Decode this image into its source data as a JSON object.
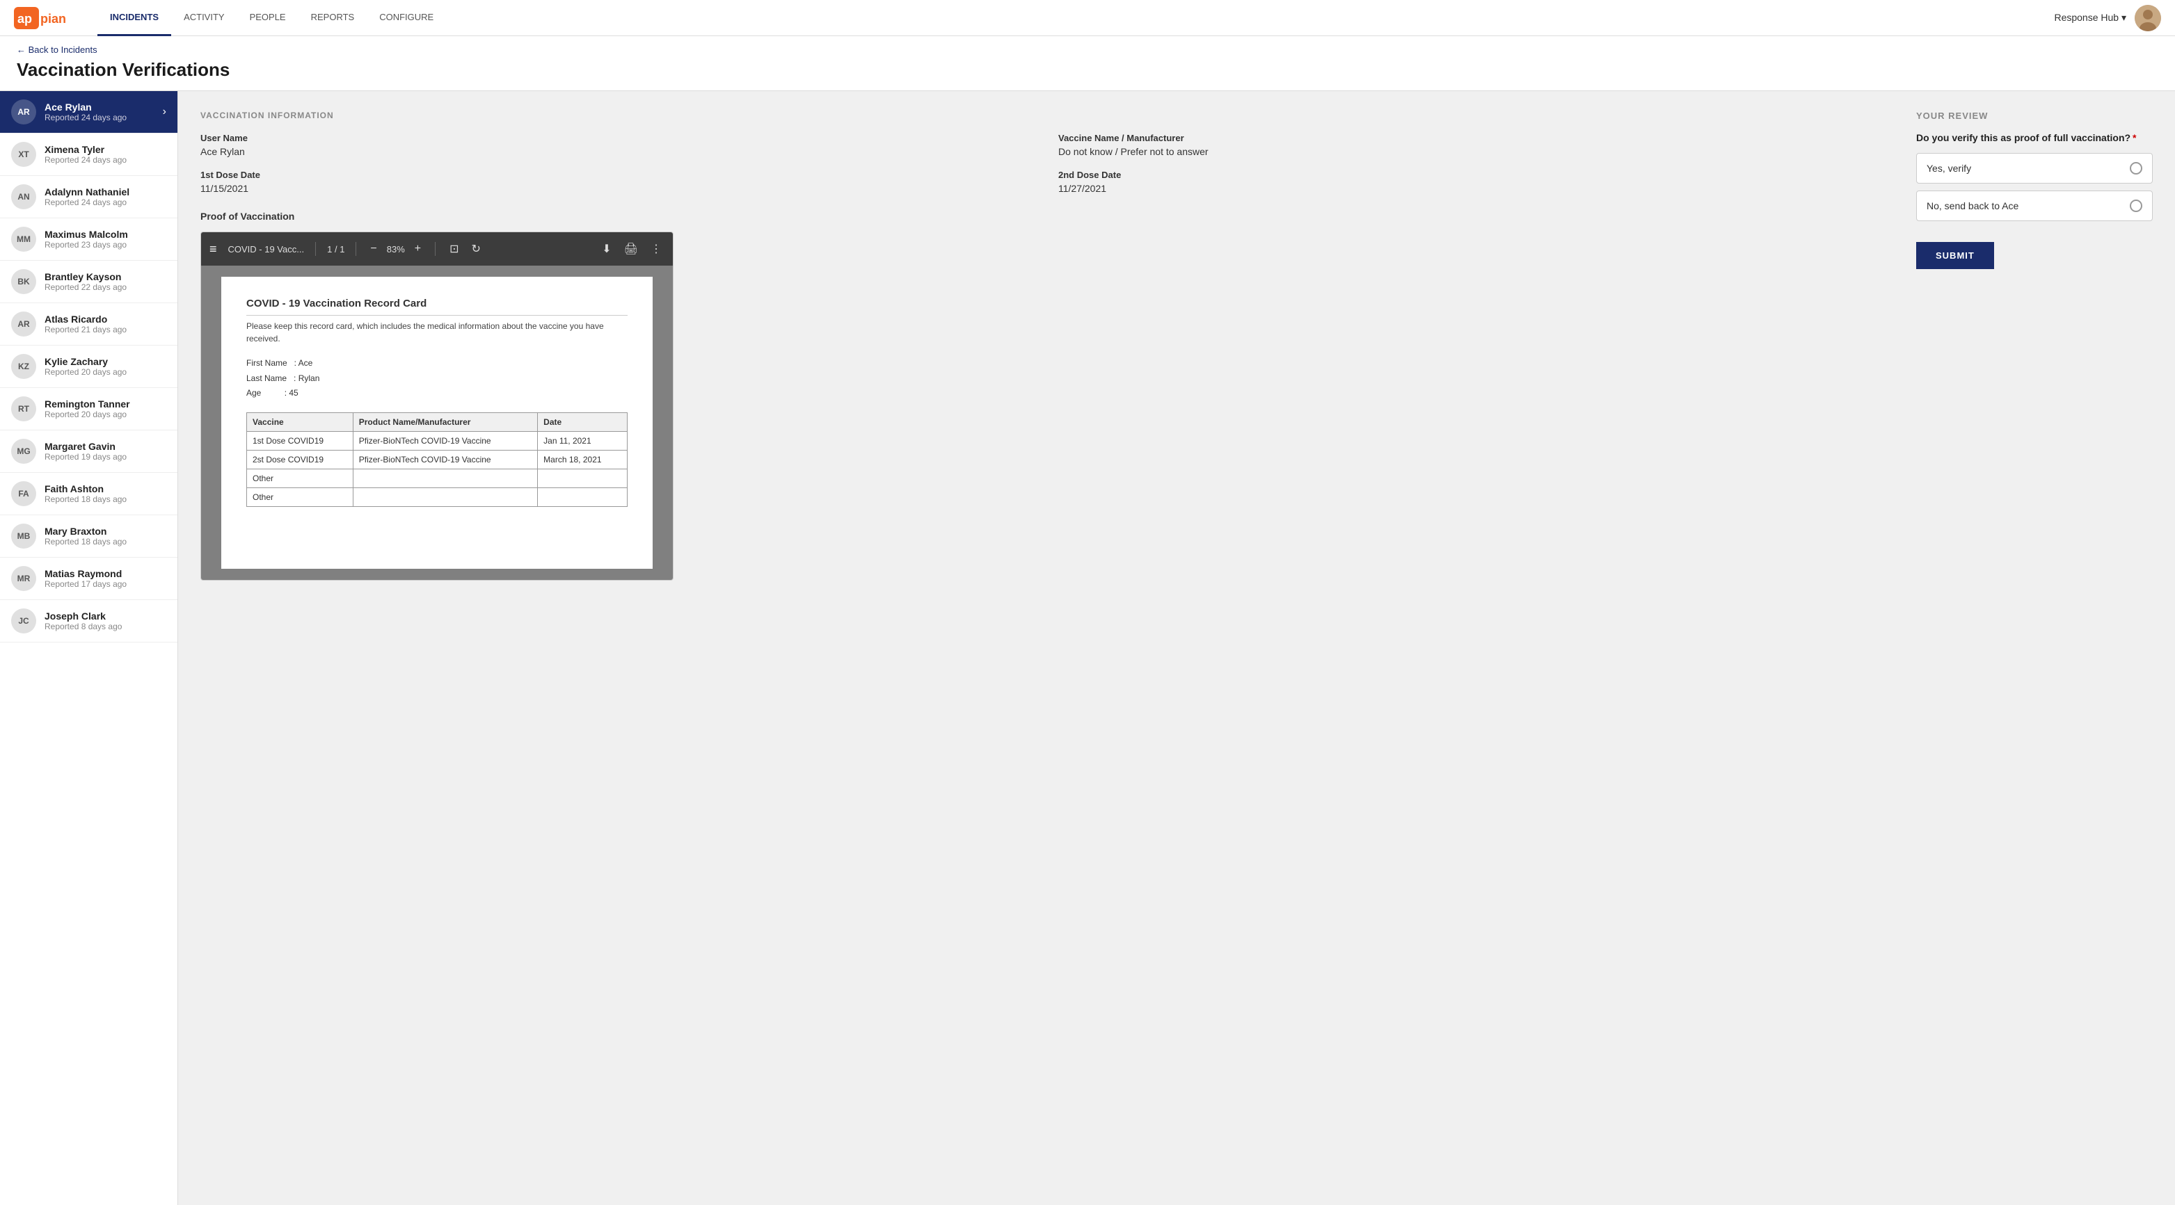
{
  "nav": {
    "links": [
      {
        "id": "incidents",
        "label": "INCIDENTS",
        "active": true
      },
      {
        "id": "activity",
        "label": "ACTIVITY",
        "active": false
      },
      {
        "id": "people",
        "label": "PEOPLE",
        "active": false
      },
      {
        "id": "reports",
        "label": "REPORTS",
        "active": false
      },
      {
        "id": "configure",
        "label": "CONFIGURE",
        "active": false
      }
    ],
    "app_name": "Response Hub",
    "dropdown_arrow": "▾"
  },
  "header": {
    "back_label": "← Back to Incidents",
    "title": "Vaccination Verifications"
  },
  "sidebar": {
    "items": [
      {
        "id": "ace-rylan",
        "initials": "AR",
        "name": "Ace Rylan",
        "sub": "Reported 24 days ago",
        "active": true
      },
      {
        "id": "ximena-tyler",
        "initials": "XT",
        "name": "Ximena Tyler",
        "sub": "Reported 24 days ago",
        "active": false
      },
      {
        "id": "adalynn-nathaniel",
        "initials": "AN",
        "name": "Adalynn Nathaniel",
        "sub": "Reported 24 days ago",
        "active": false
      },
      {
        "id": "maximus-malcolm",
        "initials": "MM",
        "name": "Maximus Malcolm",
        "sub": "Reported 23 days ago",
        "active": false
      },
      {
        "id": "brantley-kayson",
        "initials": "BK",
        "name": "Brantley Kayson",
        "sub": "Reported 22 days ago",
        "active": false
      },
      {
        "id": "atlas-ricardo",
        "initials": "AR",
        "name": "Atlas Ricardo",
        "sub": "Reported 21 days ago",
        "active": false
      },
      {
        "id": "kylie-zachary",
        "initials": "KZ",
        "name": "Kylie Zachary",
        "sub": "Reported 20 days ago",
        "active": false
      },
      {
        "id": "remington-tanner",
        "initials": "RT",
        "name": "Remington Tanner",
        "sub": "Reported 20 days ago",
        "active": false
      },
      {
        "id": "margaret-gavin",
        "initials": "MG",
        "name": "Margaret Gavin",
        "sub": "Reported 19 days ago",
        "active": false
      },
      {
        "id": "faith-ashton",
        "initials": "FA",
        "name": "Faith Ashton",
        "sub": "Reported 18 days ago",
        "active": false
      },
      {
        "id": "mary-braxton",
        "initials": "MB",
        "name": "Mary Braxton",
        "sub": "Reported 18 days ago",
        "active": false
      },
      {
        "id": "matias-raymond",
        "initials": "MR",
        "name": "Matias Raymond",
        "sub": "Reported 17 days ago",
        "active": false
      },
      {
        "id": "joseph-clark",
        "initials": "JC",
        "name": "Joseph Clark",
        "sub": "Reported 8 days ago",
        "active": false
      }
    ]
  },
  "vaccination": {
    "section_label": "VACCINATION INFORMATION",
    "user_name_label": "User Name",
    "user_name_value": "Ace Rylan",
    "vaccine_name_label": "Vaccine Name / Manufacturer",
    "vaccine_name_value": "Do not know / Prefer not to answer",
    "dose1_label": "1st Dose Date",
    "dose1_value": "11/15/2021",
    "dose2_label": "2nd Dose Date",
    "dose2_value": "11/27/2021",
    "proof_label": "Proof of Vaccination",
    "pdf": {
      "filename": "COVID - 19 Vacc...",
      "page_current": "1",
      "page_total": "1",
      "zoom": "83%",
      "content_title": "COVID - 19 Vaccination Record Card",
      "content_desc": "Please keep this record card, which includes the medical information about the vaccine you have received.",
      "person": {
        "first_name_label": "First Name",
        "first_name_value": "Ace",
        "last_name_label": "Last Name",
        "last_name_value": "Rylan",
        "age_label": "Age",
        "age_value": "45"
      },
      "table_headers": [
        "Vaccine",
        "Product Name/Manufacturer",
        "Date"
      ],
      "table_rows": [
        [
          "1st Dose COVID19",
          "Pfizer-BioNTech COVID-19 Vaccine",
          "Jan 11, 2021"
        ],
        [
          "2st Dose COVID19",
          "Pfizer-BioNTech COVID-19 Vaccine",
          "March 18, 2021"
        ],
        [
          "Other",
          "",
          ""
        ],
        [
          "Other",
          "",
          ""
        ]
      ]
    }
  },
  "review": {
    "section_label": "YOUR REVIEW",
    "question": "Do you verify this as proof of full vaccination?",
    "required": "*",
    "options": [
      {
        "id": "yes",
        "label": "Yes, verify"
      },
      {
        "id": "no",
        "label": "No, send back to Ace"
      }
    ],
    "submit_label": "SUBMIT"
  }
}
